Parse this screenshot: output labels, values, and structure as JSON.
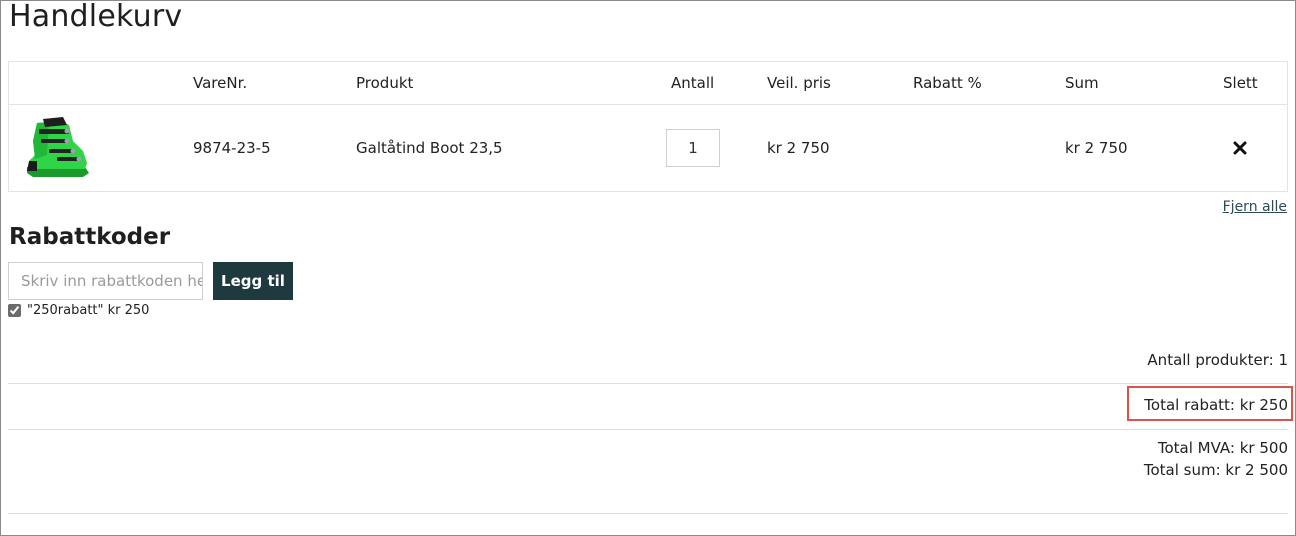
{
  "page": {
    "title": "Handlekurv"
  },
  "cart": {
    "columns": {
      "item_no": "VareNr.",
      "product": "Produkt",
      "quantity": "Antall",
      "price": "Veil. pris",
      "discount": "Rabatt %",
      "sum": "Sum",
      "delete": "Slett"
    },
    "items": [
      {
        "item_no": "9874-23-5",
        "product": "Galtåtind Boot 23,5",
        "quantity": "1",
        "price": "kr 2 750",
        "discount": "",
        "sum": "kr 2 750",
        "image": "ski-boot-green"
      }
    ],
    "remove_all_label": "Fjern alle"
  },
  "discount_codes": {
    "title": "Rabattkoder",
    "input_placeholder": "Skriv inn rabattkoden her",
    "input_value": "",
    "add_button_label": "Legg til",
    "applied": [
      {
        "label": "\"250rabatt\" kr 250",
        "checked": true
      }
    ]
  },
  "summary": {
    "product_count": "Antall produkter: 1",
    "total_discount": "Total rabatt: kr 250",
    "total_vat": "Total MVA: kr 500",
    "total_sum": "Total sum: kr 2 500"
  },
  "colors": {
    "button_bg": "#1f3a3e",
    "highlight_border": "#d9534f",
    "link": "#2d4a55"
  }
}
